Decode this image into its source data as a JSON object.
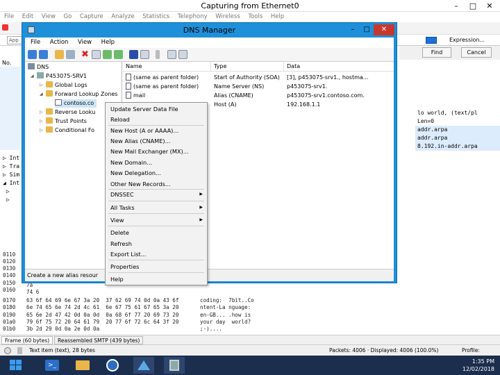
{
  "wireshark": {
    "title": "Capturing from Ethernet0",
    "menu": [
      "File",
      "Edit",
      "View",
      "Go",
      "Capture",
      "Analyze",
      "Statistics",
      "Telephony",
      "Wireless",
      "Tools",
      "Help"
    ],
    "filter_placeholder": "App",
    "expression_label": "Expression...",
    "find_button": "Find",
    "cancel_button": "Cancel",
    "packet_col_header": "No.",
    "packet_right_lines": [
      "lo world,  (text/pl",
      "  Len=0",
      "addr.arpa",
      "addr.arpa",
      "8.192.in-addr.arpa"
    ],
    "detail_lines": [
      "Int",
      "Tra",
      "Sim",
      "Int"
    ],
    "hex_rows": [
      {
        "off": "0110",
        "hex": "",
        "asc": ""
      },
      {
        "off": "0120",
        "hex": "",
        "asc": ""
      },
      {
        "off": "0130",
        "hex": "",
        "asc": ""
      },
      {
        "off": "0140",
        "hex": "",
        "asc": ""
      },
      {
        "off": "0150",
        "hex": "",
        "asc": ""
      },
      {
        "off": "0160",
        "hex": "",
        "asc": ""
      },
      {
        "off": "0170",
        "hex": "63 6f 64 69 6e 67 3a 20  37 62 69 74 0d 0a 43 6f",
        "asc": "coding:  7bit..Co"
      },
      {
        "off": "0180",
        "hex": "6e 74 65 6e 74 2d 4c 61  6e 67 75 61 67 65 3a 20",
        "asc": "ntent-La nguage:"
      },
      {
        "off": "0190",
        "hex": "65 6e 2d 47 42 0d 0a 0d  0a 68 6f 77 20 69 73 20",
        "asc": "en-GB... .how is"
      },
      {
        "off": "01a0",
        "hex": "79 6f 75 72 20 64 61 79  20 77 6f 72 6c 64 3f 20",
        "asc": "your day  world?"
      },
      {
        "off": "01b0",
        "hex": "3b 2d 29 0d 0a 2e 0d 0a",
        "asc": ";-)...."
      }
    ],
    "hex_left_partial": [
      "7a",
      "74 6"
    ],
    "tabs": [
      "Frame (60 bytes)",
      "Reassembled SMTP (439 bytes)"
    ],
    "status_left": "Text item (text), 28 bytes",
    "status_packets": "Packets: 4006 · Displayed: 4006 (100.0%)",
    "status_profile": "Profile: Default"
  },
  "taskbar": {
    "time": "1:35 PM",
    "date": "12/02/2018"
  },
  "dns": {
    "title": "DNS Manager",
    "menu": [
      "File",
      "Action",
      "View",
      "Help"
    ],
    "tree": {
      "root": "DNS",
      "server": "P453075-SRV1",
      "global_logs": "Global Logs",
      "forward": "Forward Lookup Zones",
      "zone": "contoso.co",
      "reverse": "Reverse Looku",
      "trust": "Trust Points",
      "conditional": "Conditional Fo"
    },
    "columns": [
      "Name",
      "Type",
      "Data"
    ],
    "records": [
      {
        "name": "(same as parent folder)",
        "type": "Start of Authority (SOA)",
        "data": "[3], p453075-srv1., hostma..."
      },
      {
        "name": "(same as parent folder)",
        "type": "Name Server (NS)",
        "data": "p453075-srv1."
      },
      {
        "name": "mail",
        "type": "Alias (CNAME)",
        "data": "p453075-srv1.contoso.com."
      },
      {
        "name": "",
        "type": "Host (A)",
        "data": "192.168.1.1"
      }
    ],
    "status": "Create a new alias resour"
  },
  "context_menu": {
    "items": [
      {
        "label": "Update Server Data File",
        "sub": false
      },
      {
        "label": "Reload",
        "sub": false
      },
      {
        "label": "New Host (A or AAAA)...",
        "sub": false
      },
      {
        "label": "New Alias (CNAME)...",
        "sub": false
      },
      {
        "label": "New Mail Exchanger (MX)...",
        "sub": false
      },
      {
        "label": "New Domain...",
        "sub": false
      },
      {
        "label": "New Delegation...",
        "sub": false
      },
      {
        "label": "Other New Records...",
        "sub": false
      },
      {
        "label": "DNSSEC",
        "sub": true
      },
      {
        "label": "All Tasks",
        "sub": true
      },
      {
        "label": "View",
        "sub": true
      },
      {
        "label": "Delete",
        "sub": false
      },
      {
        "label": "Refresh",
        "sub": false
      },
      {
        "label": "Export List...",
        "sub": false
      },
      {
        "label": "Properties",
        "sub": false
      },
      {
        "label": "Help",
        "sub": false
      }
    ]
  },
  "colors": {
    "dns_frame": "#1e8fd9",
    "taskbar": "#1c2e4d",
    "close_red": "#c7372e",
    "selection": "#dcecfc"
  }
}
